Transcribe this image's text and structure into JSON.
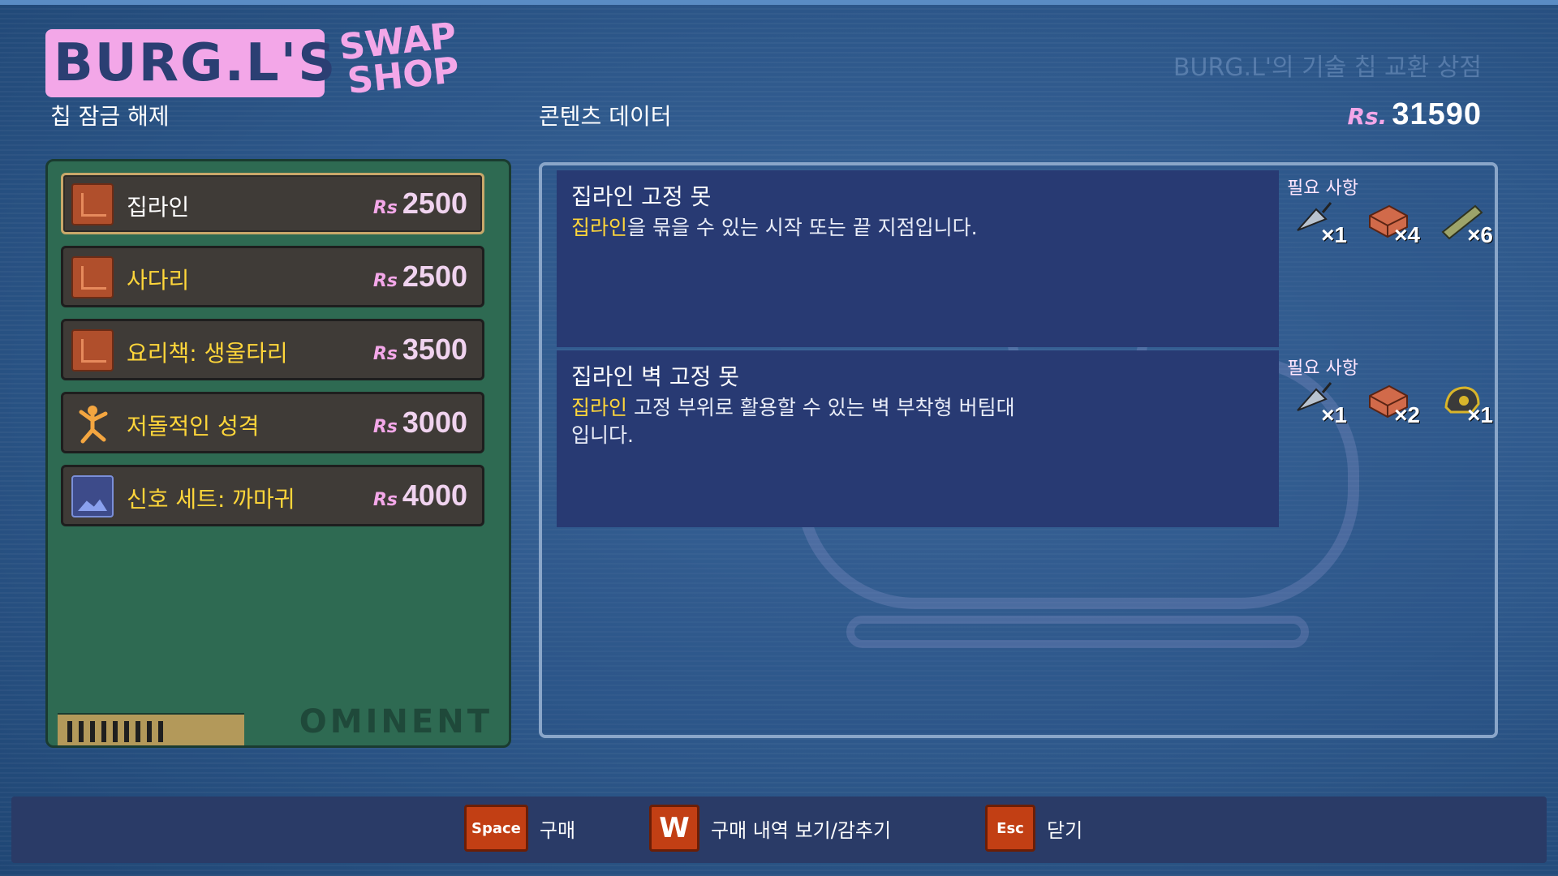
{
  "header": {
    "logo_text": "BURG.L'S",
    "logo_swap": "SWAP",
    "logo_shop": "SHOP",
    "shop_title": "BURG.L'의 기술 칩 교환 상점",
    "left_label": "칩 잠금 해제",
    "mid_label": "콘텐츠 데이터",
    "currency_symbol": "Rs.",
    "currency_amount": "31590"
  },
  "chip": {
    "brand": "OMINENT",
    "items": [
      {
        "name": "집라인",
        "price_symbol": "Rs",
        "price": "2500",
        "icon": "furniture-icon",
        "selected": true
      },
      {
        "name": "사다리",
        "price_symbol": "Rs",
        "price": "2500",
        "icon": "furniture-icon",
        "selected": false
      },
      {
        "name": "요리책: 생울타리",
        "price_symbol": "Rs",
        "price": "3500",
        "icon": "furniture-icon",
        "selected": false
      },
      {
        "name": "저돌적인 성격",
        "price_symbol": "Rs",
        "price": "3000",
        "icon": "person-icon",
        "selected": false
      },
      {
        "name": "신호 세트: 까마귀",
        "price_symbol": "Rs",
        "price": "4000",
        "icon": "image-icon",
        "selected": false
      }
    ]
  },
  "details": [
    {
      "title": "집라인 고정 못",
      "body_hl": "집라인",
      "body_rest": "을 묶을 수 있는 시작 또는 끝 지점입니다.",
      "req_label": "필요 사항",
      "requirements": [
        {
          "icon": "drill-icon",
          "count": "×1"
        },
        {
          "icon": "brick-icon",
          "count": "×4"
        },
        {
          "icon": "stick-icon",
          "count": "×6"
        }
      ]
    },
    {
      "title": "집라인 벽 고정 못",
      "body_hl": "집라인",
      "body_rest": " 고정 부위로 활용할 수 있는 벽 부착형 버팀대입니다.",
      "req_label": "필요 사항",
      "requirements": [
        {
          "icon": "drill-icon",
          "count": "×1"
        },
        {
          "icon": "brick-icon",
          "count": "×2"
        },
        {
          "icon": "helmet-icon",
          "count": "×1"
        }
      ]
    }
  ],
  "bottom": {
    "buy_key": "Space",
    "buy_label": "구매",
    "history_key": "W",
    "history_label": "구매 내역 보기/감추기",
    "close_key": "Esc",
    "close_label": "닫기"
  },
  "colors": {
    "accent_pink": "#f3a7e8",
    "highlight_yellow": "#ffd63a",
    "key_orange": "#c23f14",
    "chip_green": "#2e6a52"
  }
}
